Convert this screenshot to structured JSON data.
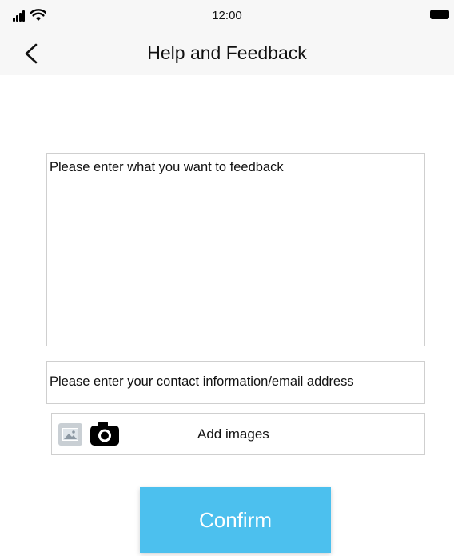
{
  "status_bar": {
    "time": "12:00",
    "signal_icon": "cellular-signal-icon",
    "wifi_icon": "wifi-icon",
    "battery_icon": "battery-icon"
  },
  "nav": {
    "title": "Help and Feedback",
    "back_icon": "chevron-left-icon"
  },
  "form": {
    "feedback_placeholder": "Please enter what you want to feedback",
    "contact_placeholder": "Please enter your contact information/email address",
    "add_images_label": "Add images",
    "gallery_icon": "image-gallery-icon",
    "camera_icon": "camera-icon",
    "confirm_label": "Confirm"
  },
  "colors": {
    "confirm_button": "#4cc0ee",
    "header_background": "#f7f7f7"
  }
}
